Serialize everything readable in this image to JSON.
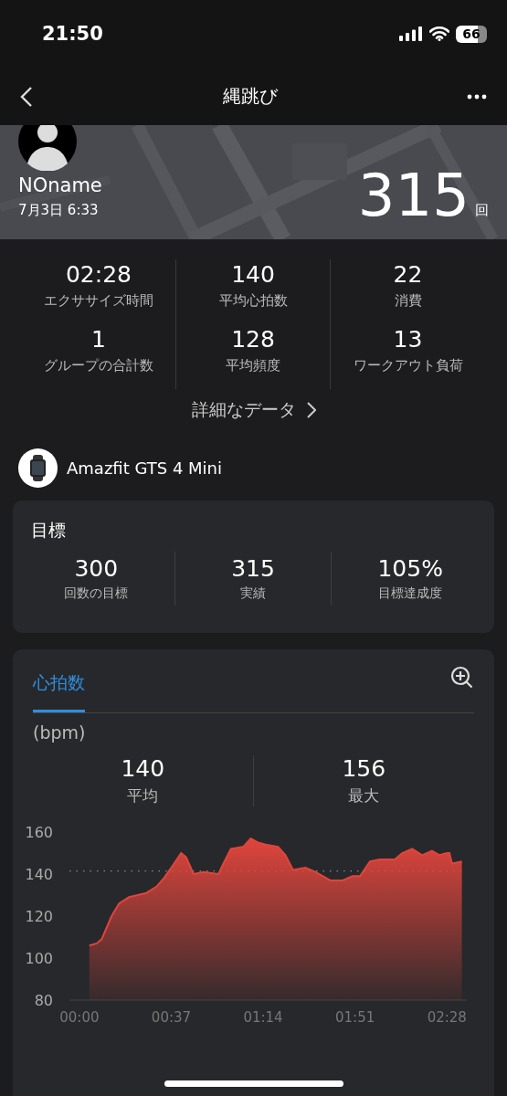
{
  "status_bar": {
    "time": "21:50",
    "battery": "66"
  },
  "nav": {
    "title": "縄跳び"
  },
  "summary": {
    "name": "NOname",
    "date": "7月3日 6:33",
    "count": "315",
    "unit": "回"
  },
  "stats": [
    {
      "value": "02:28",
      "label": "エクササイズ時間"
    },
    {
      "value": "140",
      "label": "平均心拍数"
    },
    {
      "value": "22",
      "label": "消費"
    },
    {
      "value": "1",
      "label": "グループの合計数"
    },
    {
      "value": "128",
      "label": "平均頻度"
    },
    {
      "value": "13",
      "label": "ワークアウト負荷"
    }
  ],
  "details_link": "詳細なデータ",
  "device": {
    "name": "Amazfit GTS 4 Mini"
  },
  "goal": {
    "title": "目標",
    "items": [
      {
        "value": "300",
        "label": "回数の目標"
      },
      {
        "value": "315",
        "label": "実績"
      },
      {
        "value": "105%",
        "label": "目標達成度"
      }
    ]
  },
  "heart_rate": {
    "tabs": [
      {
        "label": "心拍数",
        "selected": true
      }
    ],
    "unit": "(bpm)",
    "summary": [
      {
        "value": "140",
        "label": "平均"
      },
      {
        "value": "156",
        "label": "最大"
      }
    ],
    "chart_data": {
      "type": "area",
      "xlim": [
        -4,
        156
      ],
      "ylim": [
        80,
        160
      ],
      "yticks": [
        80,
        100,
        120,
        140,
        160
      ],
      "xticks": [
        {
          "value": 0,
          "label": "00:00"
        },
        {
          "value": 37,
          "label": "00:37"
        },
        {
          "value": 74,
          "label": "01:14"
        },
        {
          "value": 111,
          "label": "01:51"
        },
        {
          "value": 148,
          "label": "02:28"
        }
      ],
      "x": [
        4,
        7,
        9,
        13,
        16,
        20,
        27,
        31,
        34,
        37,
        41,
        43,
        46,
        50,
        56,
        58,
        61,
        66,
        69,
        72,
        75,
        80,
        83,
        86,
        91,
        95,
        101,
        106,
        110,
        113,
        117,
        121,
        127,
        130,
        134,
        138,
        142,
        145,
        148,
        149,
        150,
        154
      ],
      "series": [
        {
          "color": "#e0453c",
          "values": [
            106,
            107,
            109,
            120,
            126,
            129,
            131,
            134,
            138,
            143,
            150,
            148,
            140,
            141,
            140,
            145,
            152,
            153,
            157,
            155,
            154,
            153,
            149,
            142,
            143,
            141,
            137,
            137,
            139,
            139,
            146,
            147,
            147,
            150,
            152,
            149,
            151,
            149,
            150,
            150,
            145,
            146
          ]
        }
      ]
    }
  }
}
